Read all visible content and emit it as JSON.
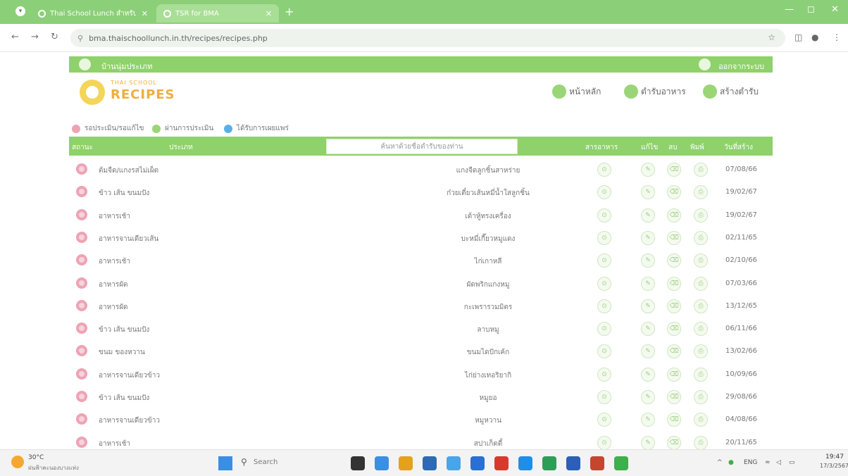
{
  "browser": {
    "tabs": [
      {
        "title": "Thai School Lunch สำหรับ สำนั"
      },
      {
        "title": "TSR for BMA"
      }
    ],
    "new_tab": "+",
    "url": "bma.thaischoollunch.in.th/recipes/recipes.php",
    "window_controls": [
      "—",
      "◻",
      "✕"
    ]
  },
  "site": {
    "topbar": {
      "home_label": "บ้านนุ่มประเภท",
      "login_label": "ออกจากระบบ"
    },
    "logo": {
      "small": "THAI SCHOOL",
      "big": "RECIPES"
    },
    "nav": [
      {
        "label": "หน้าหลัก"
      },
      {
        "label": "ตำรับอาหาร"
      },
      {
        "label": "สร้างตำรับ"
      }
    ],
    "legend": [
      {
        "label": "รอประเมิน/รอแก้ไข",
        "color": "#eea3b4"
      },
      {
        "label": "ผ่านการประเมิน",
        "color": "#9ad577"
      },
      {
        "label": "ได้รับการเผยแพร่",
        "color": "#5ab0e6"
      }
    ],
    "table": {
      "headers": {
        "status": "สถานะ",
        "type": "ประเภท",
        "nutrition": "สารอาหาร",
        "edit": "แก้ไข",
        "delete": "ลบ",
        "print": "พิมพ์",
        "created": "วันที่สร้าง"
      },
      "search_placeholder": "ค้นหาด้วยชื่อตำรับของท่าน",
      "rows": [
        {
          "type": "ต้มจืด/แกงรสไม่เผ็ด",
          "name": "แกงจืดลูกชิ้นสาหร่าย",
          "date": "07/08/66"
        },
        {
          "type": "ข้าว เส้น ขนมปัง",
          "name": "ก๋วยเตี๋ยวเส้นหมี่น้ำใสลูกชิ้น",
          "date": "19/02/67"
        },
        {
          "type": "อาหารเช้า",
          "name": "เต้าหู้ทรงเครื่อง",
          "date": "19/02/67"
        },
        {
          "type": "อาหารจานเดียวเส้น",
          "name": "บะหมี่เกี๊ยวหมูแดง",
          "date": "02/11/65"
        },
        {
          "type": "อาหารเช้า",
          "name": "ไก่เกาหลี",
          "date": "02/10/66"
        },
        {
          "type": "อาหารผัด",
          "name": "ผัดพริกแกงหมู",
          "date": "07/03/66"
        },
        {
          "type": "อาหารผัด",
          "name": "กะเพรารวมมิตร",
          "date": "13/12/65"
        },
        {
          "type": "ข้าว เส้น ขนมปัง",
          "name": "ลาบหมู",
          "date": "06/11/66"
        },
        {
          "type": "ขนม ของหวาน",
          "name": "ขนมไดปักเค้ก",
          "date": "13/02/66"
        },
        {
          "type": "อาหารจานเดียวข้าว",
          "name": "ไก่ย่างเทอริยากิ",
          "date": "10/09/66"
        },
        {
          "type": "ข้าว เส้น ขนมปัง",
          "name": "หมูยอ",
          "date": "29/08/66"
        },
        {
          "type": "อาหารจานเดียวข้าว",
          "name": "หมูหวาน",
          "date": "04/08/66"
        },
        {
          "type": "อาหารเช้า",
          "name": "สปาเก็ตตี้",
          "date": "20/11/65"
        }
      ]
    }
  },
  "taskbar": {
    "temp": "30°C",
    "weather_desc": "ฝนฟ้าคะนองบางแห่ง",
    "search_label": "Search",
    "lang": "ENG",
    "time": "19:47",
    "date": "17/3/2567",
    "app_colors": [
      "#333333",
      "#3b8ee6",
      "#e3a21a",
      "#2d6ab3",
      "#4aa5e8",
      "#2a6fd6",
      "#d9392b",
      "#1f8ee8",
      "#2e9e57",
      "#2b5fb8",
      "#c5452f",
      "#3fae4c"
    ]
  }
}
